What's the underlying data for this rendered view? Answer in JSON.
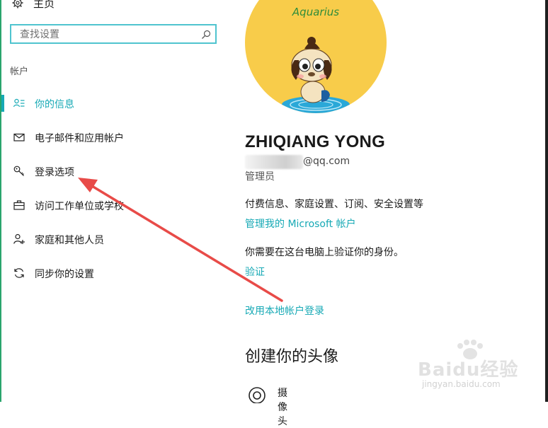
{
  "sidebar": {
    "home_label": "主页",
    "search": {
      "placeholder": "查找设置",
      "value": ""
    },
    "section_header": "帐户",
    "items": [
      {
        "label": "你的信息",
        "icon": "person-list-icon",
        "selected": true
      },
      {
        "label": "电子邮件和应用帐户",
        "icon": "mail-icon",
        "selected": false
      },
      {
        "label": "登录选项",
        "icon": "key-icon",
        "selected": false
      },
      {
        "label": "访问工作单位或学校",
        "icon": "briefcase-icon",
        "selected": false
      },
      {
        "label": "家庭和其他人员",
        "icon": "person-add-icon",
        "selected": false
      },
      {
        "label": "同步你的设置",
        "icon": "sync-icon",
        "selected": false
      }
    ]
  },
  "main": {
    "avatar_brand": "Aquarius",
    "user_name": "ZHIQIANG YONG",
    "email_domain": "@qq.com",
    "role": "管理员",
    "billing_text": "付费信息、家庭设置、订阅、安全设置等",
    "manage_link": "管理我的 Microsoft 帐户",
    "verify_text": "你需要在这台电脑上验证你的身份。",
    "verify_link": "验证",
    "local_link": "改用本地帐户登录",
    "create_avatar_heading": "创建你的头像",
    "camera_label": "摄像头"
  },
  "watermark": {
    "brand": "Baidu经验",
    "url": "jingyan.baidu.com"
  },
  "colors": {
    "accent": "#16a9b5",
    "search_border": "#4fc4cf",
    "annotation_arrow": "#e84b48",
    "avatar_bg": "#f8cc4a"
  }
}
